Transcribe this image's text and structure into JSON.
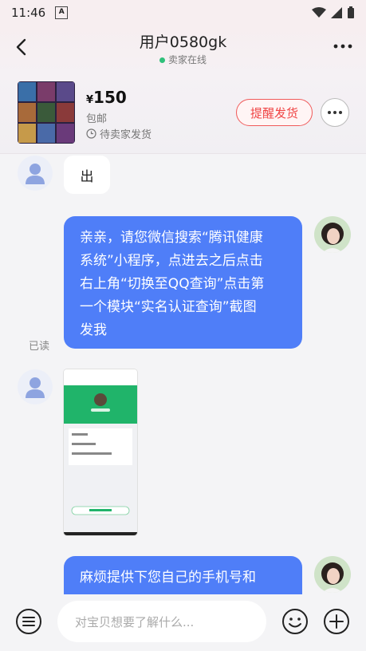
{
  "status_bar": {
    "time": "11:46",
    "a_badge": "A"
  },
  "header": {
    "title": "用户0580gk",
    "online_text": "卖家在线"
  },
  "product": {
    "currency": "¥",
    "price": "150",
    "shipping": "包邮",
    "status": "待卖家发货",
    "remind_button": "提醒发货"
  },
  "messages": {
    "m1_text": "出",
    "m2_lines": [
      "亲亲，请您微信搜索“腾讯健康",
      "系统”小程序，点进去之后点击",
      "右上角“切换至QQ查询”点击第",
      "一个模块“实名认证查询”截图",
      "发我"
    ],
    "m2_read": "已读",
    "m4_lines": [
      "麻烦提供下您自己的手机号和"
    ]
  },
  "input": {
    "placeholder": "对宝贝想要了解什么..."
  },
  "colors": {
    "accent_blue": "#4f7ef8",
    "remind_red": "#f04545",
    "online_green": "#2fc07a"
  }
}
